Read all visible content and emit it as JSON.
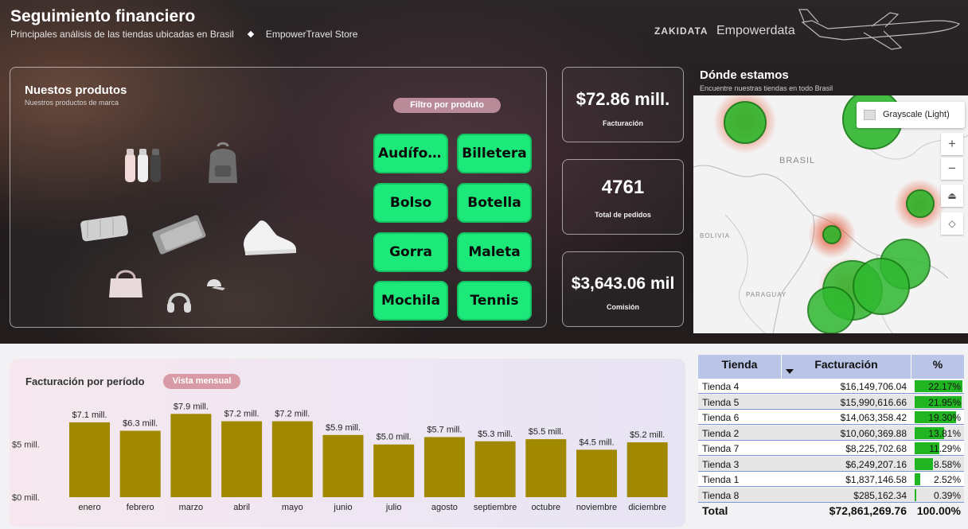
{
  "header": {
    "title": "Seguimiento financiero",
    "subtitle_left": "Principales análisis de las tiendas ubicadas en Brasil",
    "subtitle_right": "EmpowerTravel Store",
    "brand_zaki": "ZAKIDATA",
    "brand_empower": "Empowerdata"
  },
  "products": {
    "title": "Nuestos produtos",
    "subtitle": "Nuestros productos de marca",
    "filter_label": "Filtro por produto",
    "buttons": [
      "Audífon...",
      "Billetera",
      "Bolso",
      "Botella",
      "Gorra",
      "Maleta",
      "Mochila",
      "Tennis"
    ],
    "button_color": "#1de87a"
  },
  "kpis": [
    {
      "value": "$72.86 mill.",
      "label": "Facturación"
    },
    {
      "value": "4761",
      "label": "Total de pedidos"
    },
    {
      "value": "$3,643.06 mil",
      "label": "Comisión"
    }
  ],
  "map": {
    "title": "Dónde estamos",
    "subtitle": "Encuentre nuestras tiendas en todo Brasil",
    "style_button": "Grayscale (Light)",
    "labels": [
      "BRASIL",
      "BOLIVIA",
      "PARAGUAY"
    ],
    "controls": [
      "+",
      "−",
      "⏏",
      "◇"
    ],
    "marker_color": "#2fb82f",
    "heat_color": "#e0401a"
  },
  "period": {
    "title": "Facturación por período",
    "view_label": "Vista mensual"
  },
  "chart_data": {
    "type": "bar",
    "categories": [
      "enero",
      "febrero",
      "marzo",
      "abril",
      "mayo",
      "junio",
      "julio",
      "agosto",
      "septiembre",
      "octubre",
      "noviembre",
      "diciembre"
    ],
    "values": [
      7.1,
      6.3,
      7.9,
      7.2,
      7.2,
      5.9,
      5.0,
      5.7,
      5.3,
      5.5,
      4.5,
      5.2
    ],
    "data_labels": [
      "$7.1 mill.",
      "$6.3 mill.",
      "$7.9 mill.",
      "$7.2 mill.",
      "$7.2 mill.",
      "$5.9 mill.",
      "$5.0 mill.",
      "$5.7 mill.",
      "$5.3 mill.",
      "$5.5 mill.",
      "$4.5 mill.",
      "$5.2 mill."
    ],
    "y_ticks": [
      {
        "value": 0,
        "label": "$0 mill."
      },
      {
        "value": 5,
        "label": "$5 mill."
      }
    ],
    "ylim": [
      0,
      8.3
    ],
    "unit": "mill.",
    "bar_color": "#a08800",
    "grid": false
  },
  "table": {
    "headers": {
      "store": "Tienda",
      "revenue": "Facturación",
      "pct": "%"
    },
    "rows": [
      {
        "store": "Tienda 4",
        "revenue": "$16,149,706.04",
        "pct": "22.17%",
        "share": 22.17
      },
      {
        "store": "Tienda 5",
        "revenue": "$15,990,616.66",
        "pct": "21.95%",
        "share": 21.95
      },
      {
        "store": "Tienda 6",
        "revenue": "$14,063,358.42",
        "pct": "19.30%",
        "share": 19.3
      },
      {
        "store": "Tienda 2",
        "revenue": "$10,060,369.88",
        "pct": "13.81%",
        "share": 13.81
      },
      {
        "store": "Tienda 7",
        "revenue": "$8,225,702.68",
        "pct": "11.29%",
        "share": 11.29
      },
      {
        "store": "Tienda 3",
        "revenue": "$6,249,207.16",
        "pct": "8.58%",
        "share": 8.58
      },
      {
        "store": "Tienda 1",
        "revenue": "$1,837,146.58",
        "pct": "2.52%",
        "share": 2.52
      },
      {
        "store": "Tienda 8",
        "revenue": "$285,162.34",
        "pct": "0.39%",
        "share": 0.39
      }
    ],
    "total": {
      "label": "Total",
      "revenue": "$72,861,269.76",
      "pct": "100.00%"
    }
  }
}
